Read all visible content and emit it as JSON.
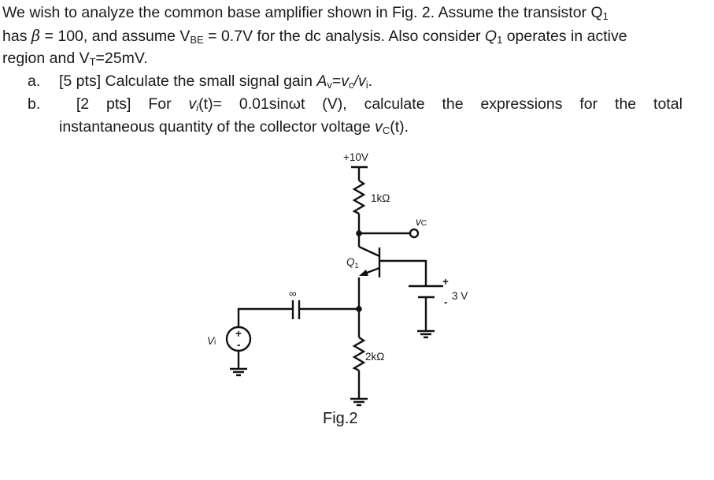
{
  "problem": {
    "intro": {
      "line1_a": "We wish to analyze the common base amplifier shown in Fig. 2. Assume the transistor Q",
      "line1_sub": "1",
      "line2_a": "has ",
      "line2_beta": "β",
      "line2_b": " = 100, and assume V",
      "line2_sub": "BE",
      "line2_c": " = 0.7V for the dc analysis. Also consider ",
      "line2_q": "Q",
      "line2_qsub": "1",
      "line2_d": " operates in active",
      "line3_a": "region and V",
      "line3_sub": "T",
      "line3_b": "=25mV."
    },
    "parts": [
      {
        "marker": "a.",
        "points": "[5 pts]",
        "text_a": "Calculate the small signal gain ",
        "av": "A",
        "av_sub": "v",
        "eq": "=",
        "vc": "v",
        "vc_sub": "c",
        "slash": "/",
        "vi": "v",
        "vi_sub": "i",
        "end": "."
      },
      {
        "marker": "b.",
        "words": [
          "[2",
          "pts]",
          "For",
          "v_i(t)=",
          "0.01sinωt",
          "(V),",
          "calculate",
          "the",
          "expressions",
          "for",
          "the",
          "total"
        ],
        "vi_var": "v",
        "vi_sub": "i",
        "vi_rest": "(t)=",
        "line2_a": "instantaneous quantity of the collector voltage ",
        "line2_v": "v",
        "line2_sub": "C",
        "line2_b": "(t)."
      }
    ]
  },
  "circuit": {
    "supply_label": "+10V",
    "rc_label": "1kΩ",
    "output_label_v": "v",
    "output_label_sub": "C",
    "transistor_label": "Q",
    "transistor_sub": "1",
    "capacitor_label": "∞",
    "battery_plus": "+",
    "battery_minus": "-",
    "battery_label": "3 V",
    "source_label_v": "V",
    "source_label_sub": "i",
    "source_plus": "+",
    "source_minus": "-",
    "re_label": "2kΩ"
  },
  "figure": {
    "caption": "Fig.2"
  }
}
